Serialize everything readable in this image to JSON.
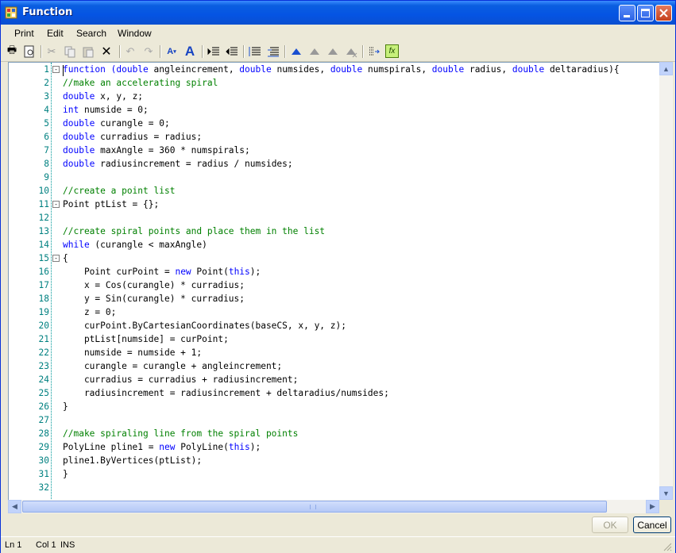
{
  "window": {
    "title": "Function"
  },
  "menu": [
    "Print",
    "Edit",
    "Search",
    "Window"
  ],
  "status": {
    "line": "Ln 1",
    "col": "Col 1",
    "mode": "INS"
  },
  "buttons": {
    "ok": "OK",
    "cancel": "Cancel"
  },
  "toolbar_icons": [
    "print-icon",
    "print-preview-icon",
    "cut-icon",
    "copy-icon",
    "paste-icon",
    "delete-icon",
    "undo-icon",
    "redo-icon",
    "decrease-font-icon",
    "increase-font-icon",
    "indent-icon",
    "outdent-icon",
    "comment-icon",
    "uncomment-icon",
    "bookmark-icon",
    "next-bookmark-icon",
    "prev-bookmark-icon",
    "clear-bookmarks-icon",
    "goto-line-icon",
    "insert-function-icon"
  ],
  "code": [
    {
      "n": "1",
      "fold": "-",
      "segs": [
        {
          "t": "function (",
          "c": "kw"
        },
        {
          "t": "double",
          "c": "kw"
        },
        {
          "t": " angleincrement, "
        },
        {
          "t": "double",
          "c": "kw"
        },
        {
          "t": " numsides, "
        },
        {
          "t": "double",
          "c": "kw"
        },
        {
          "t": " numspirals, "
        },
        {
          "t": "double",
          "c": "kw"
        },
        {
          "t": " radius, "
        },
        {
          "t": "double",
          "c": "kw"
        },
        {
          "t": " deltaradius){"
        }
      ]
    },
    {
      "n": "2",
      "segs": [
        {
          "t": "//make an accelerating spiral",
          "c": "cm"
        }
      ]
    },
    {
      "n": "3",
      "segs": [
        {
          "t": "double",
          "c": "kw"
        },
        {
          "t": " x, y, z;"
        }
      ]
    },
    {
      "n": "4",
      "segs": [
        {
          "t": "int",
          "c": "kw"
        },
        {
          "t": " numside = 0;"
        }
      ]
    },
    {
      "n": "5",
      "segs": [
        {
          "t": "double",
          "c": "kw"
        },
        {
          "t": " curangle = 0;"
        }
      ]
    },
    {
      "n": "6",
      "segs": [
        {
          "t": "double",
          "c": "kw"
        },
        {
          "t": " curradius = radius;"
        }
      ]
    },
    {
      "n": "7",
      "segs": [
        {
          "t": "double",
          "c": "kw"
        },
        {
          "t": " maxAngle = 360 * numspirals;"
        }
      ]
    },
    {
      "n": "8",
      "segs": [
        {
          "t": "double",
          "c": "kw"
        },
        {
          "t": " radiusincrement = radius / numsides;"
        }
      ]
    },
    {
      "n": "9",
      "segs": []
    },
    {
      "n": "10",
      "segs": [
        {
          "t": "//create a point list",
          "c": "cm"
        }
      ]
    },
    {
      "n": "11",
      "fold": "-",
      "segs": [
        {
          "t": "Point ptList = {};"
        }
      ]
    },
    {
      "n": "12",
      "segs": []
    },
    {
      "n": "13",
      "segs": [
        {
          "t": "//create spiral points and place them in the list",
          "c": "cm"
        }
      ]
    },
    {
      "n": "14",
      "segs": [
        {
          "t": "while",
          "c": "kw"
        },
        {
          "t": " (curangle < maxAngle)"
        }
      ]
    },
    {
      "n": "15",
      "fold": "-",
      "segs": [
        {
          "t": "{"
        }
      ]
    },
    {
      "n": "16",
      "segs": [
        {
          "t": "    Point curPoint = "
        },
        {
          "t": "new",
          "c": "kw"
        },
        {
          "t": " Point("
        },
        {
          "t": "this",
          "c": "kw"
        },
        {
          "t": ");"
        }
      ]
    },
    {
      "n": "17",
      "segs": [
        {
          "t": "    x = Cos(curangle) * curradius;"
        }
      ]
    },
    {
      "n": "18",
      "segs": [
        {
          "t": "    y = Sin(curangle) * curradius;"
        }
      ]
    },
    {
      "n": "19",
      "segs": [
        {
          "t": "    z = 0;"
        }
      ]
    },
    {
      "n": "20",
      "segs": [
        {
          "t": "    curPoint.ByCartesianCoordinates(baseCS, x, y, z);"
        }
      ]
    },
    {
      "n": "21",
      "segs": [
        {
          "t": "    ptList[numside] = curPoint;"
        }
      ]
    },
    {
      "n": "22",
      "segs": [
        {
          "t": "    numside = numside + 1;"
        }
      ]
    },
    {
      "n": "23",
      "segs": [
        {
          "t": "    curangle = curangle + angleincrement;"
        }
      ]
    },
    {
      "n": "24",
      "segs": [
        {
          "t": "    curradius = curradius + radiusincrement;"
        }
      ]
    },
    {
      "n": "25",
      "segs": [
        {
          "t": "    radiusincrement = radiusincrement + deltaradius/numsides;"
        }
      ]
    },
    {
      "n": "26",
      "segs": [
        {
          "t": "}"
        }
      ]
    },
    {
      "n": "27",
      "segs": []
    },
    {
      "n": "28",
      "segs": [
        {
          "t": "//make spiraling line from the spiral points",
          "c": "cm"
        }
      ]
    },
    {
      "n": "29",
      "segs": [
        {
          "t": "PolyLine pline1 = "
        },
        {
          "t": "new",
          "c": "kw"
        },
        {
          "t": " PolyLine("
        },
        {
          "t": "this",
          "c": "kw"
        },
        {
          "t": ");"
        }
      ]
    },
    {
      "n": "30",
      "segs": [
        {
          "t": "pline1.ByVertices(ptList);"
        }
      ]
    },
    {
      "n": "31",
      "segs": [
        {
          "t": "}"
        }
      ]
    },
    {
      "n": "32",
      "segs": []
    }
  ]
}
